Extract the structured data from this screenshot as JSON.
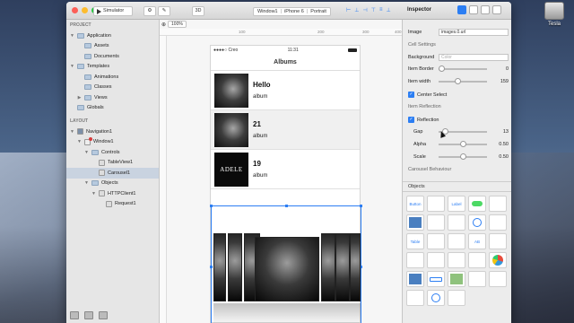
{
  "desktop": {
    "disk_label": "Tesla"
  },
  "toolbar": {
    "run_label": "Simulator",
    "zoom": "100%",
    "threed_label": "3D",
    "breadcrumbs": [
      "Window1",
      "iPhone 6",
      "Portrait"
    ],
    "inspector_title": "Inspector"
  },
  "sidebar": {
    "project_header": "PROJECT",
    "layout_header": "LAYOUT",
    "project_items": [
      {
        "label": "Application",
        "depth": 0,
        "tri": "▼",
        "icon": "folder"
      },
      {
        "label": "Assets",
        "depth": 1,
        "tri": "",
        "icon": "folder"
      },
      {
        "label": "Documents",
        "depth": 1,
        "tri": "",
        "icon": "folder"
      },
      {
        "label": "Templates",
        "depth": 0,
        "tri": "▼",
        "icon": "folder"
      },
      {
        "label": "Animations",
        "depth": 1,
        "tri": "",
        "icon": "folder"
      },
      {
        "label": "Classes",
        "depth": 1,
        "tri": "",
        "icon": "folder"
      },
      {
        "label": "Views",
        "depth": 1,
        "tri": "▶",
        "icon": "folder"
      },
      {
        "label": "Globals",
        "depth": 0,
        "tri": "",
        "icon": "folder"
      }
    ],
    "layout_items": [
      {
        "label": "Navigation1",
        "depth": 0,
        "tri": "▼",
        "icon": "nav"
      },
      {
        "label": "Window1",
        "depth": 1,
        "tri": "▼",
        "icon": "win"
      },
      {
        "label": "Controls",
        "depth": 2,
        "tri": "▼",
        "icon": "folder"
      },
      {
        "label": "TableView1",
        "depth": 3,
        "tri": "",
        "icon": "ui"
      },
      {
        "label": "Carousel1",
        "depth": 3,
        "tri": "",
        "icon": "ui",
        "selected": true
      },
      {
        "label": "Objects",
        "depth": 2,
        "tri": "▼",
        "icon": "folder"
      },
      {
        "label": "HTTPClient1",
        "depth": 3,
        "tri": "▼",
        "icon": "ui"
      },
      {
        "label": "Request1",
        "depth": 4,
        "tri": "",
        "icon": "ui"
      }
    ]
  },
  "canvas": {
    "ruler_labels": [
      "100",
      "200",
      "300",
      "400"
    ],
    "status_carrier": "●●●●○ Creo",
    "status_time": "11:31",
    "nav_title": "Albums",
    "albums": [
      {
        "title": "Hello",
        "subtitle": "album",
        "cover_text": ""
      },
      {
        "title": "21",
        "subtitle": "album",
        "cover_text": ""
      },
      {
        "title": "19",
        "subtitle": "album",
        "cover_text": "ADELE"
      }
    ]
  },
  "inspector": {
    "image_label": "Image",
    "image_value": "images.0.url",
    "cell_settings_header": "Cell Settings",
    "background_label": "Background",
    "background_placeholder": "Color",
    "item_border_label": "Item Border",
    "item_border_value": "0",
    "item_width_label": "Item width",
    "item_width_value": "159",
    "center_select_label": "Center Select",
    "item_reflection_header": "Item Reflection",
    "reflection_label": "Reflection",
    "gap_label": "Gap",
    "gap_value": "13",
    "alpha_label": "Alpha",
    "alpha_value": "0.50",
    "scale_label": "Scale",
    "scale_value": "0.50",
    "carousel_behaviour_header": "Carousel Behaviour",
    "objects_header": "Objects",
    "objects": [
      {
        "label": "Button",
        "kind": "text"
      },
      {
        "label": "",
        "kind": "dashed"
      },
      {
        "label": "Label",
        "kind": "text"
      },
      {
        "label": "",
        "kind": "switch"
      },
      {
        "label": "",
        "kind": "slider"
      },
      {
        "label": "",
        "kind": "image"
      },
      {
        "label": "",
        "kind": "progress"
      },
      {
        "label": "",
        "kind": "spinner"
      },
      {
        "label": "",
        "kind": "circle"
      },
      {
        "label": "",
        "kind": "picker"
      },
      {
        "label": "Table",
        "kind": "text"
      },
      {
        "label": "",
        "kind": "grid"
      },
      {
        "label": "",
        "kind": "compass"
      },
      {
        "label": "AB",
        "kind": "text"
      },
      {
        "label": "",
        "kind": "share"
      },
      {
        "label": "",
        "kind": "doc"
      },
      {
        "label": "",
        "kind": "search"
      },
      {
        "label": "",
        "kind": "field"
      },
      {
        "label": "",
        "kind": "web"
      },
      {
        "label": "",
        "kind": "pie"
      },
      {
        "label": "",
        "kind": "image"
      },
      {
        "label": "",
        "kind": "seg"
      },
      {
        "label": "",
        "kind": "map"
      },
      {
        "label": "",
        "kind": "corner"
      },
      {
        "label": "",
        "kind": "blank"
      },
      {
        "label": "",
        "kind": "square"
      },
      {
        "label": "",
        "kind": "circle"
      },
      {
        "label": "",
        "kind": "pentagon"
      }
    ]
  }
}
